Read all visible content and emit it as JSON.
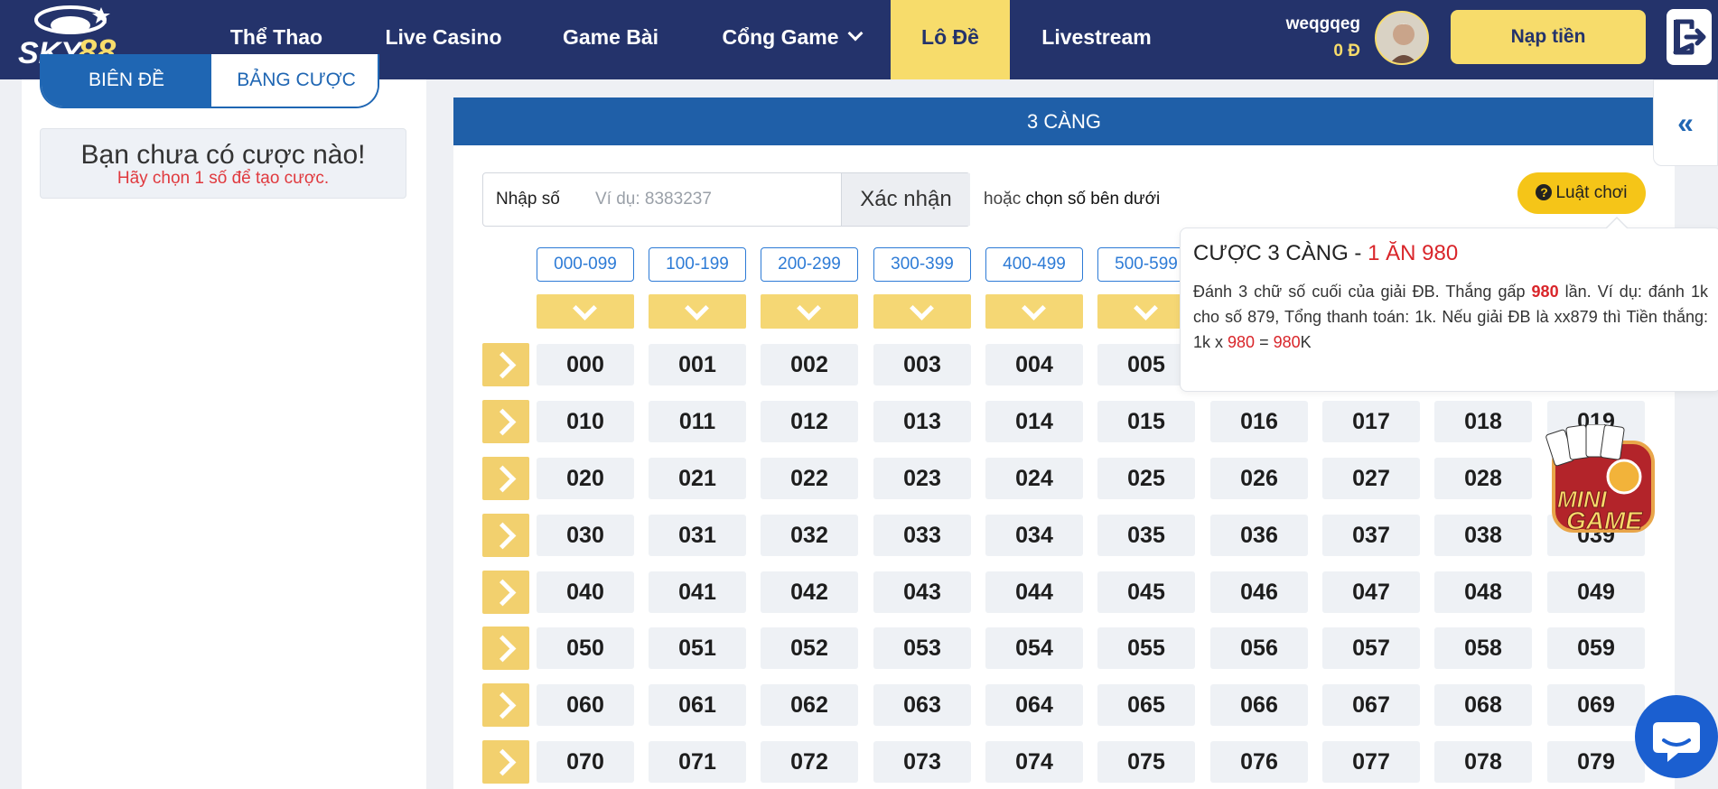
{
  "header": {
    "logo_text": "SKY88",
    "nav": [
      {
        "label": "Thể Thao"
      },
      {
        "label": "Live Casino"
      },
      {
        "label": "Game Bài"
      },
      {
        "label": "Cổng Game"
      },
      {
        "label": "Lô Đề"
      },
      {
        "label": "Livestream"
      }
    ],
    "user": {
      "name": "weqgqeg",
      "balance": "0 Đ"
    },
    "deposit_label": "Nạp tiền",
    "icons": {
      "logout": "logout-icon",
      "avatar": "user-avatar",
      "dropdown": "chevron-down-icon"
    }
  },
  "left": {
    "tabs": [
      {
        "label": "BIÊN ĐỀ"
      },
      {
        "label": "BẢNG CƯỢC"
      }
    ],
    "empty_title": "Bạn chưa có cược nào!",
    "empty_sub": "Hãy chọn 1 số để tạo cược."
  },
  "main": {
    "title": "3 CÀNG",
    "collapse_icon": "double-chevron-left-icon",
    "input_label": "Nhập số",
    "input_placeholder": "Ví dụ: 8383237",
    "input_value": "",
    "confirm_label": "Xác nhận",
    "or_text": "hoặc",
    "or_bold": "chọn số bên dưới",
    "rules_label": "Luật chơi",
    "ranges": [
      "000-099",
      "100-199",
      "200-299",
      "300-399",
      "400-499",
      "500-599"
    ],
    "rows": [
      [
        "000",
        "001",
        "002",
        "003",
        "004",
        "005"
      ],
      [
        "010",
        "011",
        "012",
        "013",
        "014",
        "015",
        "016",
        "017",
        "018",
        "019"
      ],
      [
        "020",
        "021",
        "022",
        "023",
        "024",
        "025",
        "026",
        "027",
        "028"
      ],
      [
        "030",
        "031",
        "032",
        "033",
        "034",
        "035",
        "036",
        "037",
        "038",
        "039"
      ],
      [
        "040",
        "041",
        "042",
        "043",
        "044",
        "045",
        "046",
        "047",
        "048",
        "049"
      ],
      [
        "050",
        "051",
        "052",
        "053",
        "054",
        "055",
        "056",
        "057",
        "058",
        "059"
      ],
      [
        "060",
        "061",
        "062",
        "063",
        "064",
        "065",
        "066",
        "067",
        "068",
        "069"
      ],
      [
        "070",
        "071",
        "072",
        "073",
        "074",
        "075",
        "076",
        "077",
        "078",
        "079"
      ]
    ]
  },
  "popover": {
    "title_black": "CƯỢC 3 CÀNG - ",
    "title_red": "1 ĂN 980",
    "p1": "Đánh 3 chữ số cuối của giải ĐB. Thắng gấp ",
    "p_hl1": "980",
    "p2": " lần. Ví dụ: đánh 1k cho số 879, Tổng thanh toán: 1k. Nếu giải ĐB là xx879 thì Tiền thắng: 1k x ",
    "p_hl2": "980",
    "p3": " = ",
    "p_hl3": "980",
    "p4": "K"
  },
  "widgets": {
    "minigame_text": "MINI GAME",
    "chat_icon": "chat-bubble-icon"
  },
  "colors": {
    "header": "#24336b",
    "accent_yellow": "#f7dc6b",
    "blue": "#1f5fa8",
    "red": "#d9252a"
  }
}
